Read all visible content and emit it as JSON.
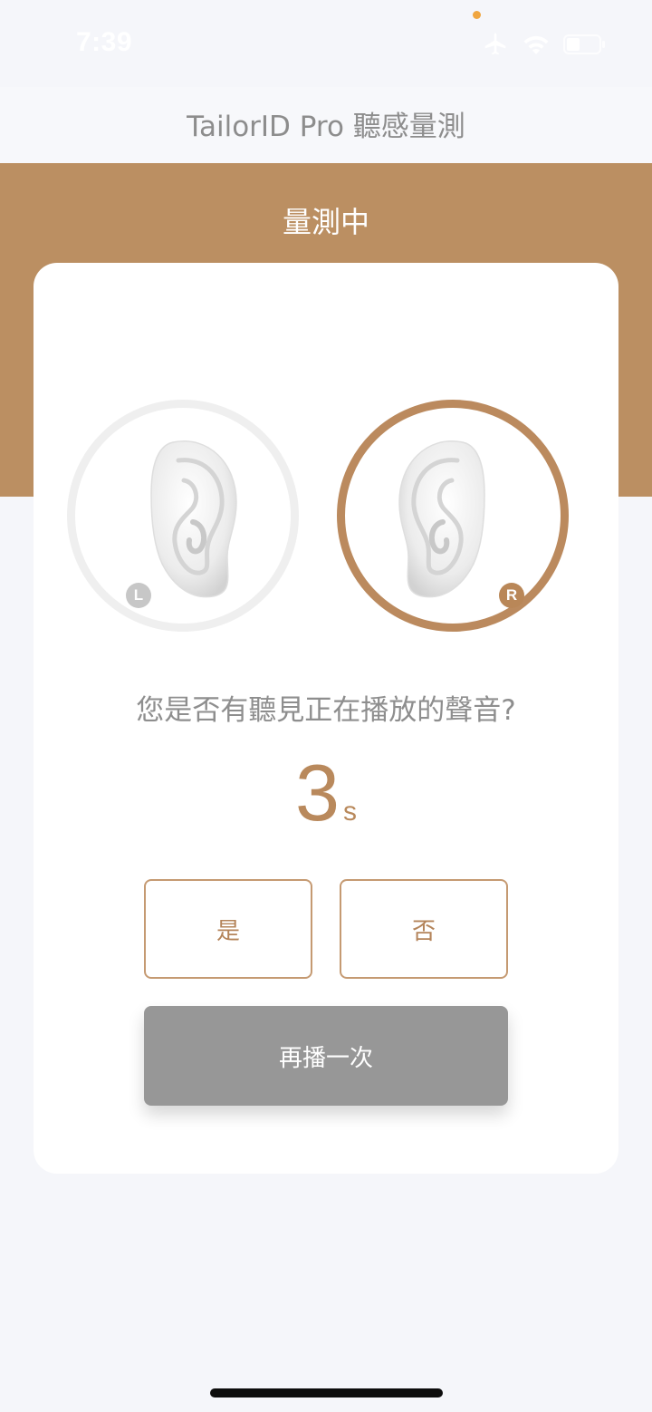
{
  "status_bar": {
    "time": "7:39",
    "icons": [
      "airplane-icon",
      "wifi-icon",
      "battery-icon"
    ],
    "camera_indicator_color": "#f0a640"
  },
  "header": {
    "title": "TailorID Pro 聽感量測"
  },
  "band": {
    "title": "量測中",
    "color": "#bb8f62"
  },
  "ears": {
    "left": {
      "label": "L",
      "active": false
    },
    "right": {
      "label": "R",
      "active": true
    }
  },
  "question": "您是否有聽見正在播放的聲音?",
  "countdown": {
    "value": "3",
    "unit": "s"
  },
  "buttons": {
    "yes": "是",
    "no": "否",
    "replay": "再播一次"
  },
  "colors": {
    "accent": "#bb8a5e",
    "background": "#f5f6fa",
    "replay_button": "#979797"
  }
}
